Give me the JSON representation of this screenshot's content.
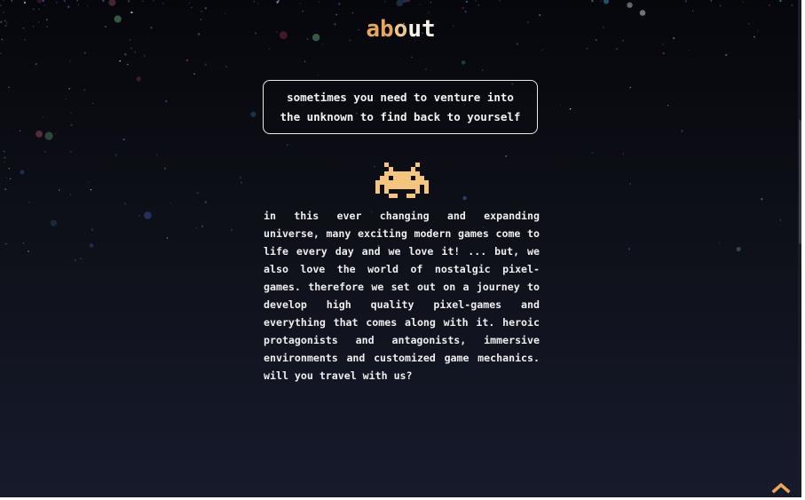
{
  "header": {
    "title_part1": "ab",
    "title_part2": "o",
    "title_part3": "ut"
  },
  "quote": {
    "line1": "sometimes you need to venture into",
    "line2": "the unknown to find back to yourself"
  },
  "mascot": {
    "icon": "space-invader-icon",
    "color": "#f5c57d"
  },
  "about": {
    "text": "in this ever changing and expanding universe, many exciting modern games come to life every day and we love it! ... but, we also love the world of nostalgic pixel-games. therefore we set out on a journey to develop high quality pixel-games and everything that comes along with it. heroic protagonists and antagonists, immersive environments and customized game mechanics. will you travel with us?"
  },
  "navigation": {
    "back_to_top_icon": "chevron-up-icon",
    "accent_color": "#e8a85a"
  },
  "colors": {
    "background_top": "#06070c",
    "background_bottom": "#161a2b",
    "text": "#eeeeee"
  }
}
